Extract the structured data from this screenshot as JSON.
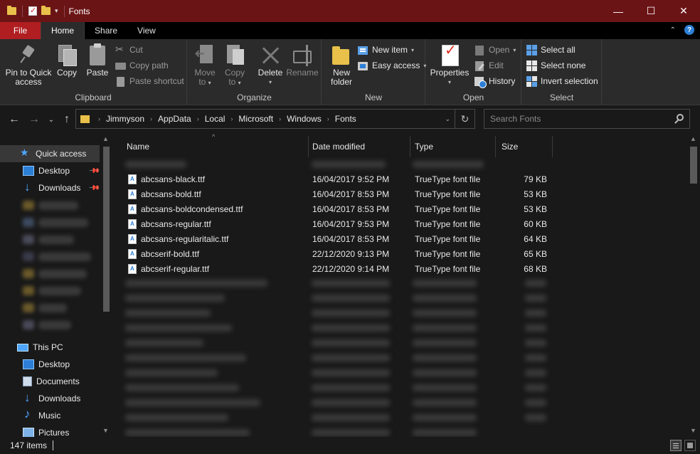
{
  "window": {
    "title": "Fonts",
    "controls": [
      "—",
      "☐",
      "✕"
    ]
  },
  "ribbon_tabs": [
    {
      "label": "File"
    },
    {
      "label": "Home"
    },
    {
      "label": "Share"
    },
    {
      "label": "View"
    }
  ],
  "ribbon": {
    "clipboard": {
      "name": "Clipboard",
      "pin_line1": "Pin to Quick",
      "pin_line2": "access",
      "copy": "Copy",
      "paste": "Paste",
      "cut": "Cut",
      "copy_path": "Copy path",
      "paste_shortcut": "Paste shortcut"
    },
    "organize": {
      "name": "Organize",
      "move_line1": "Move",
      "move_line2": "to",
      "copy_line1": "Copy",
      "copy_line2": "to",
      "delete": "Delete",
      "rename": "Rename"
    },
    "new": {
      "name": "New",
      "new_folder_line1": "New",
      "new_folder_line2": "folder",
      "new_item": "New item",
      "easy_access": "Easy access"
    },
    "open": {
      "name": "Open",
      "properties": "Properties",
      "open": "Open",
      "edit": "Edit",
      "history": "History"
    },
    "select": {
      "name": "Select",
      "select_all": "Select all",
      "select_none": "Select none",
      "invert_selection": "Invert selection"
    }
  },
  "address": {
    "crumbs": [
      "Jimmyson",
      "AppData",
      "Local",
      "Microsoft",
      "Windows",
      "Fonts"
    ]
  },
  "search": {
    "placeholder": "Search Fonts"
  },
  "sidebar": {
    "quick_access": "Quick access",
    "pinned": [
      {
        "label": "Desktop"
      },
      {
        "label": "Downloads"
      }
    ],
    "this_pc": "This PC",
    "pc_items": [
      {
        "label": "Desktop"
      },
      {
        "label": "Documents"
      },
      {
        "label": "Downloads"
      },
      {
        "label": "Music"
      },
      {
        "label": "Pictures"
      }
    ]
  },
  "columns": {
    "name": "Name",
    "date": "Date modified",
    "type": "Type",
    "size": "Size"
  },
  "files": [
    {
      "name": "abcsans-black.ttf",
      "date": "16/04/2017 9:52 PM",
      "type": "TrueType font file",
      "size": "79 KB"
    },
    {
      "name": "abcsans-bold.ttf",
      "date": "16/04/2017 8:53 PM",
      "type": "TrueType font file",
      "size": "53 KB"
    },
    {
      "name": "abcsans-boldcondensed.ttf",
      "date": "16/04/2017 8:53 PM",
      "type": "TrueType font file",
      "size": "53 KB"
    },
    {
      "name": "abcsans-regular.ttf",
      "date": "16/04/2017 9:53 PM",
      "type": "TrueType font file",
      "size": "60 KB"
    },
    {
      "name": "abcsans-regularitalic.ttf",
      "date": "16/04/2017 8:53 PM",
      "type": "TrueType font file",
      "size": "64 KB"
    },
    {
      "name": "abcserif-bold.ttf",
      "date": "22/12/2020 9:13 PM",
      "type": "TrueType font file",
      "size": "65 KB"
    },
    {
      "name": "abcserif-regular.ttf",
      "date": "22/12/2020 9:14 PM",
      "type": "TrueType font file",
      "size": "68 KB"
    }
  ],
  "status": {
    "count": "147 items"
  },
  "colors": {
    "titlebar": "#6b1416",
    "file_tab": "#b01e22",
    "background": "#191919",
    "ribbon": "#2b2b2b",
    "accent": "#4ea6ff"
  }
}
